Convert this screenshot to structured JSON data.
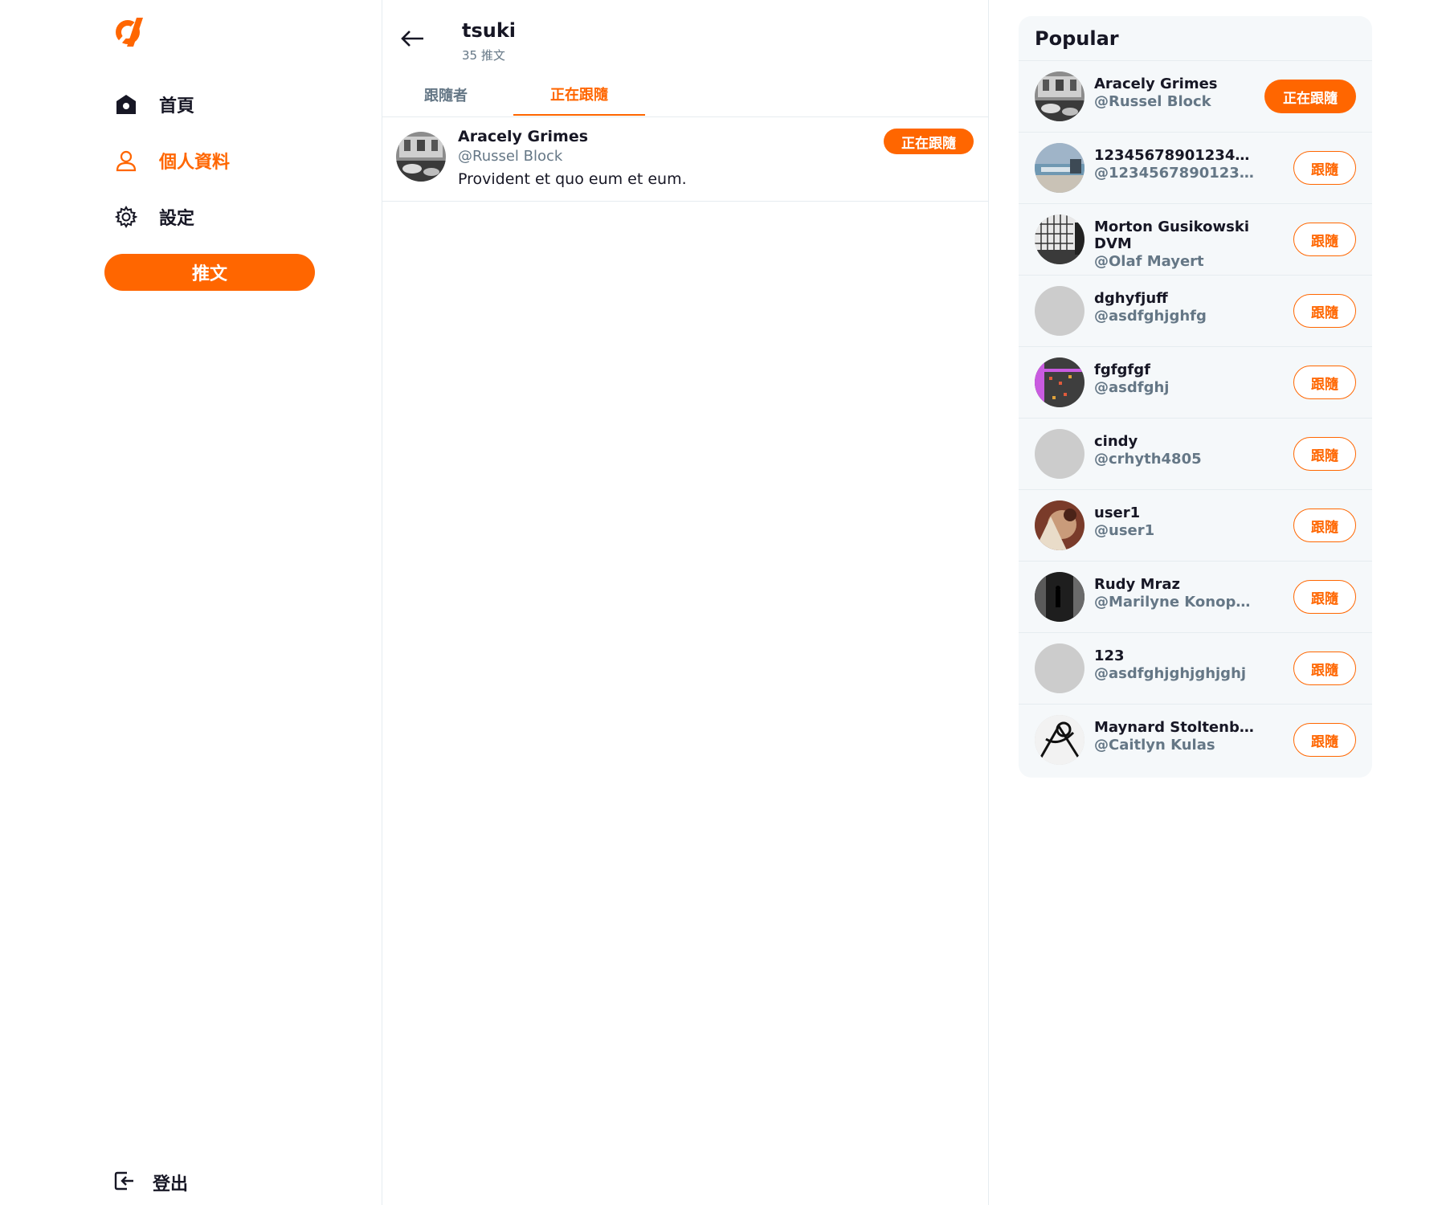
{
  "app": {
    "accent": "#ff6600"
  },
  "sidebar": {
    "logo": "alpha-logo",
    "nav": [
      {
        "icon": "home-icon",
        "label": "首頁",
        "active": false
      },
      {
        "icon": "user-icon",
        "label": "個人資料",
        "active": true
      },
      {
        "icon": "gear-icon",
        "label": "設定",
        "active": false
      }
    ],
    "tweet_button": "推文",
    "logout": {
      "icon": "logout-icon",
      "label": "登出"
    }
  },
  "header": {
    "back_icon": "arrow-left-icon",
    "title": "tsuki",
    "tweet_count": "35 推文"
  },
  "tabs": [
    {
      "label": "跟隨者",
      "active": false
    },
    {
      "label": "正在跟隨",
      "active": true
    }
  ],
  "following_list": [
    {
      "name": "Aracely Grimes",
      "handle": "@Russel Block",
      "content": "Provident et quo eum et eum.",
      "button": "正在跟隨"
    }
  ],
  "popular": {
    "title": "Popular",
    "items": [
      {
        "name": "Aracely Grimes",
        "handle": "@Russel Block",
        "button": "正在跟隨",
        "following": true,
        "avatar": "photo-street"
      },
      {
        "name": "12345678901234567...",
        "handle": "@123456789012345...",
        "button": "跟隨",
        "following": false,
        "avatar": "photo-beach"
      },
      {
        "name": "Morton Gusikowski DVM",
        "handle": "@Olaf Mayert",
        "button": "跟隨",
        "following": false,
        "avatar": "photo-building"
      },
      {
        "name": "dghyfjuff",
        "handle": "@asdfghjghfg",
        "button": "跟隨",
        "following": false,
        "avatar": "placeholder"
      },
      {
        "name": "fgfgfgf",
        "handle": "@asdfghj",
        "button": "跟隨",
        "following": false,
        "avatar": "photo-pixel"
      },
      {
        "name": "cindy",
        "handle": "@crhyth4805",
        "button": "跟隨",
        "following": false,
        "avatar": "placeholder"
      },
      {
        "name": "user1",
        "handle": "@user1",
        "button": "跟隨",
        "following": false,
        "avatar": "photo-art"
      },
      {
        "name": "Rudy Mraz",
        "handle": "@Marilyne Konopelski",
        "button": "跟隨",
        "following": false,
        "avatar": "photo-night"
      },
      {
        "name": "123",
        "handle": "@asdfghjghjghjghj",
        "button": "跟隨",
        "following": false,
        "avatar": "placeholder"
      },
      {
        "name": "Maynard Stoltenberg",
        "handle": "@Caitlyn Kulas",
        "button": "跟隨",
        "following": false,
        "avatar": "photo-sketch"
      }
    ]
  }
}
